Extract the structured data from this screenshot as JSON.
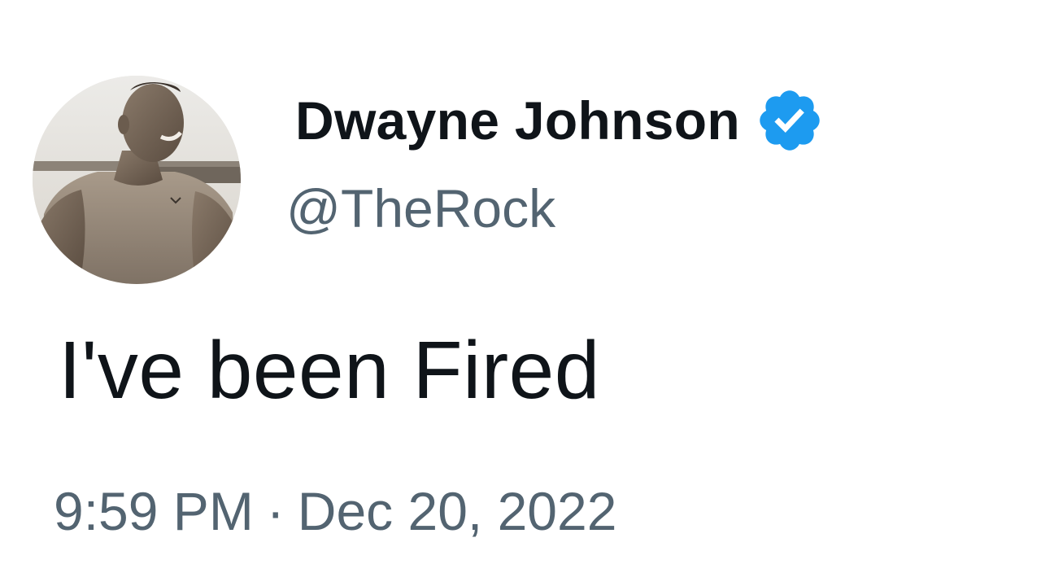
{
  "tweet": {
    "author": {
      "display_name": "Dwayne Johnson",
      "handle": "@TheRock",
      "verified": true,
      "avatar_icon": "profile-photo",
      "verified_color": "#1d9bf0"
    },
    "text": "I've been Fired",
    "timestamp": {
      "time": "9:59 PM",
      "separator": "·",
      "date": "Dec 20, 2022"
    }
  },
  "colors": {
    "primary_text": "#0f1419",
    "secondary_text": "#536471",
    "background": "#ffffff"
  }
}
